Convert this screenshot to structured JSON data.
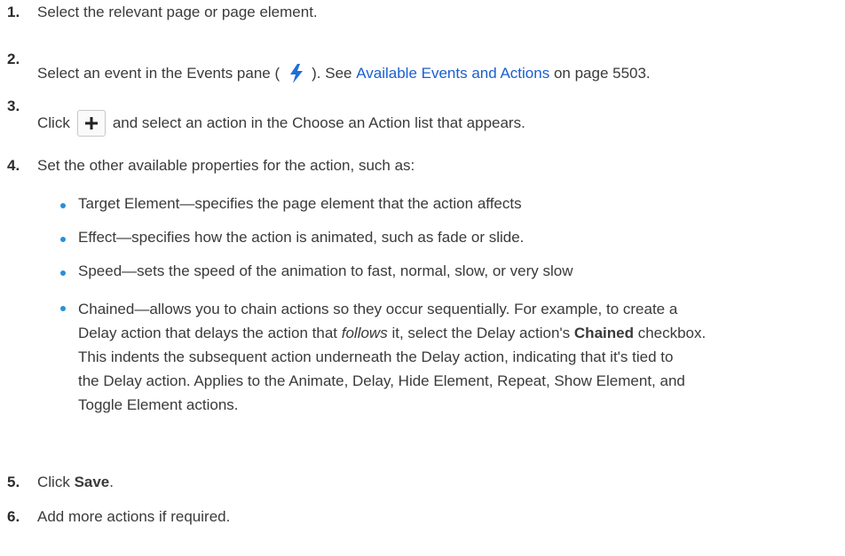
{
  "steps": [
    {
      "num": "1.",
      "text": "Select the relevant page or page element."
    },
    {
      "num": "2.",
      "pre": "Select an event in the Events pane (",
      "post": "). See ",
      "link": "Available Events and Actions",
      "after": " on page 5503."
    },
    {
      "num": "3.",
      "pre": "Click",
      "post": "and select an action in the Choose an Action list that appears."
    },
    {
      "num": "4.",
      "text": "Set the other available properties for the action, such as:"
    },
    {
      "num": "5.",
      "pre": "Click ",
      "bold": "Save",
      "post": "."
    },
    {
      "num": "6.",
      "text": "Add more actions if required."
    }
  ],
  "bullets": [
    "Target Element—specifies the page element that the action affects",
    "Effect—specifies how the action is animated, such as fade or slide.",
    "Speed—sets the speed of the animation to fast, normal, slow, or very slow"
  ],
  "chained": {
    "l1": "Chained—allows you to chain actions so they occur sequentially. For example, to create a",
    "l2_pre": "Delay action that delays the action that ",
    "l2_em": "follows",
    "l2_mid": " it, select the Delay action's ",
    "l2_bold": "Chained",
    "l2_post": " checkbox.",
    "l3": "This indents the subsequent action underneath the Delay action, indicating that it's tied to",
    "l4": "the Delay action. Applies to the Animate, Delay, Hide Element, Repeat, Show Element, and",
    "l5": "Toggle Element actions."
  },
  "icons": {
    "lightning": "lightning-icon",
    "plus": "plus-icon"
  },
  "colors": {
    "bullet": "#2a8fd8",
    "link": "#1a5fcf",
    "lightning": "#1f6fd6"
  }
}
